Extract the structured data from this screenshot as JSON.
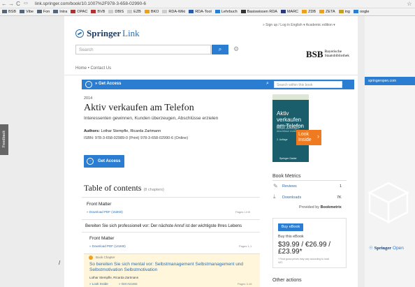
{
  "browser": {
    "url": "link.springer.com/book/10.1007%2F978-3-658-02990-6",
    "bookmarks": [
      "BSB",
      "Vibe",
      "Fon",
      "Intra",
      "OPAC",
      "BVB",
      "DBIS",
      "EZB",
      "BKO",
      "RDA-Wiki",
      "RDA-Tool",
      "Lehrbuch",
      "Basiswissen RDA",
      "MARC",
      "ZDB",
      "ZETA",
      "ing",
      "oogle"
    ]
  },
  "header": {
    "logo_springer": "Springer",
    "logo_link": "Link",
    "top_links": "» Sign up / Log in    English ▾    Academic edition ▾",
    "search_placeholder": "Search",
    "bsb_mark": "BSB",
    "bsb_line1": "Bayerische",
    "bsb_line2": "Staatsbibliothek",
    "breadcrumb_home": "Home",
    "breadcrumb_contact": "• Contact Us"
  },
  "access_bar": {
    "label": "» Get Access",
    "search_placeholder": "Search within this book"
  },
  "book": {
    "year": "2014",
    "title": "Aktiv verkaufen am Telefon",
    "subtitle": "Interessenten gewinnen, Kunden überzeugen, Abschlüsse erzielen",
    "authors_label": "Authors:",
    "authors": "Lothar Stempfle, Ricarda Zartmann",
    "isbn": "ISBN: 978-3-658-02989-0 (Print) 978-3-658-02990-6 (Online)",
    "get_access": "Get Access"
  },
  "cover": {
    "title": "Aktiv verkaufen am Telefon",
    "sub": "Interessenten gewinnen, Kunden überzeugen, Abschlüsse erzielen",
    "edition": "2. Auflage",
    "publisher": "Springer Gabler",
    "look_inside": "Look Inside"
  },
  "metrics": {
    "title": "Book Metrics",
    "reviews_label": "Reviews",
    "reviews_value": "1",
    "downloads_label": "Downloads",
    "downloads_value": "7K",
    "provided_prefix": "Provided by",
    "provided_brand": "Bookmetrix"
  },
  "buy": {
    "button": "Buy eBook",
    "this": "Buy this eBook",
    "price": "$39.99 / €26.99 / £23.99*",
    "note": "* Final gross prices may vary according to local VAT.",
    "other_actions": "Other actions"
  },
  "toc": {
    "title": "Table of contents",
    "count": "(8 chapters)",
    "front_matter_1": "Front Matter",
    "front_matter_1_dl": "» Download PDF (153KB)",
    "front_matter_1_pages": "Pages I-XIII",
    "chapter0": "Bereiten Sie sich professionell vor: Der nächste Anruf ist der wichtigste Ihres Lebens",
    "front_matter_2": "Front Matter",
    "front_matter_2_dl": "» Download PDF (141KB)",
    "front_matter_2_pages": "Pages 1-1",
    "chapter_kind": "Book Chapter",
    "chapter_title": "So bereiten Sie sich mental vor: Selbstmanagement Selbstmanagement und Selbstmotivation Selbstmotivation",
    "chapter_authors": "Lothar Stempfle, Ricarda Zartmann",
    "chapter_look": "» Look Inside",
    "chapter_access": "» Get Access",
    "chapter_pages": "Pages 3-16"
  },
  "right": {
    "banner": "springeropen.com",
    "logo_springer": "Springer",
    "logo_open": "Open"
  },
  "feedback": "Feedback",
  "left_mark": "/"
}
